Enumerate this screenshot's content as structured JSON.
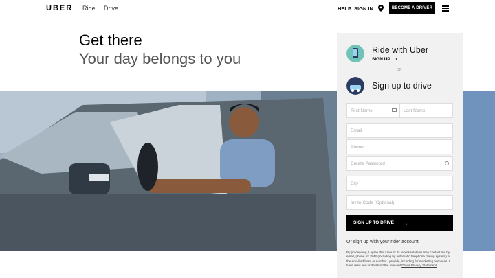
{
  "nav": {
    "logo": "UBER",
    "ride": "Ride",
    "drive": "Drive",
    "help": "HELP",
    "sign_in": "SIGN IN",
    "become_driver": "BECOME A DRIVER"
  },
  "hero": {
    "title": "Get there",
    "subtitle": "Your day belongs to you"
  },
  "panel": {
    "ride_title": "Ride with Uber",
    "ride_signup": "SIGN UP",
    "or": "OR",
    "drive_title": "Sign up to drive",
    "fields": {
      "first_name": "First Name",
      "last_name": "Last Name",
      "email": "Email",
      "phone": "Phone",
      "password": "Create Password",
      "city": "City",
      "invite": "Invite Code (Optional)"
    },
    "submit": "SIGN UP TO DRIVE",
    "rider_prefix": "Or",
    "rider_link": "sign up",
    "rider_suffix": "with your rider account.",
    "legal": "By proceeding, I agree that Uber or its representatives may contact me by email, phone, or SMS (including by automatic telephone dialing system) at the email address or number I provide, including for marketing purposes. I have read and understand the relevant",
    "legal_link": "Driver Privacy Statement"
  },
  "colors": {
    "accent": "#000000",
    "panel_bg": "#f1f1f1"
  }
}
